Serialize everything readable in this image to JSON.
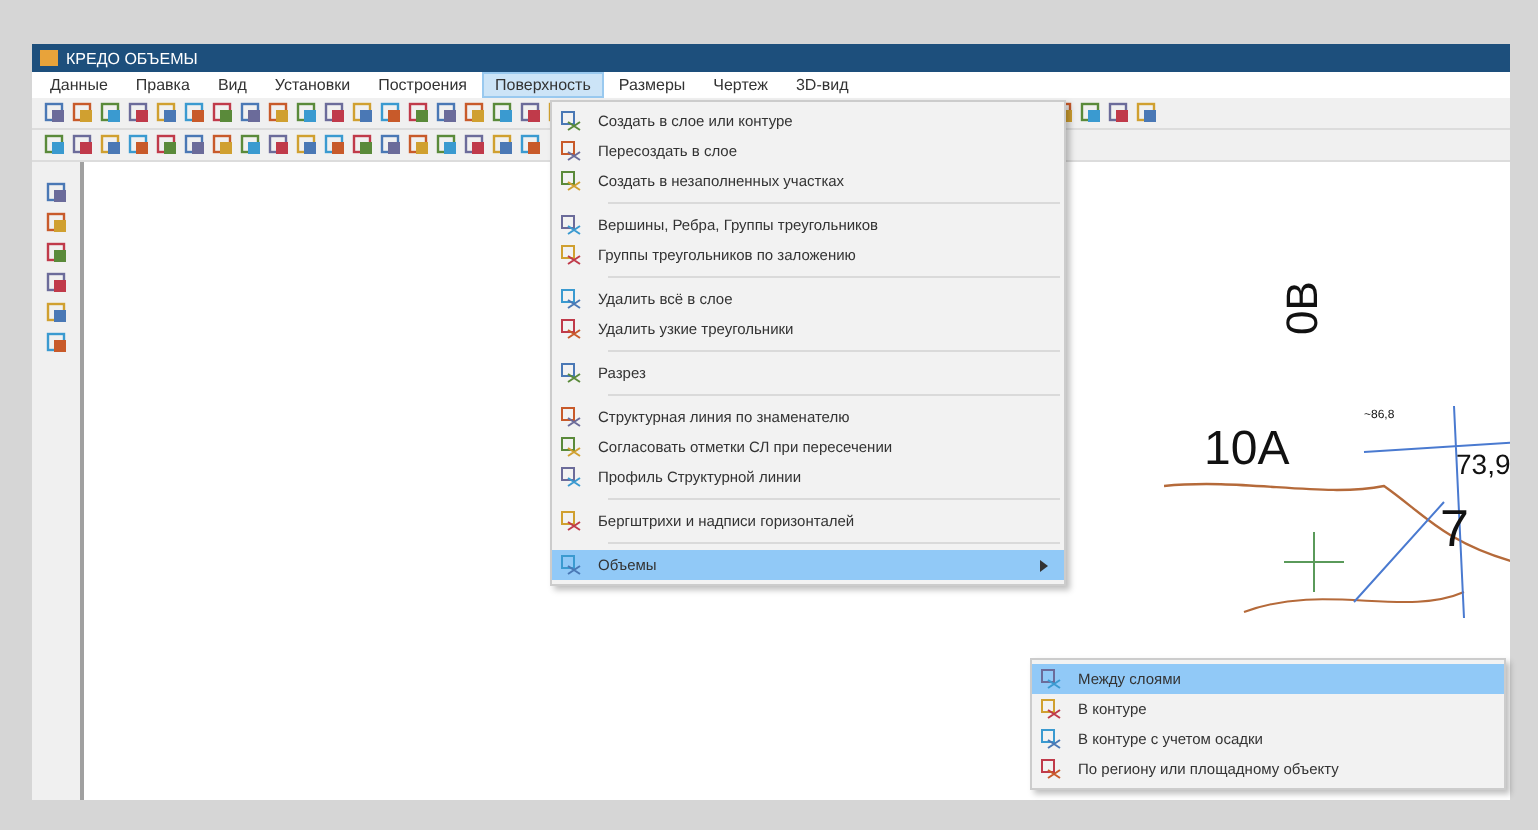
{
  "window": {
    "title": "КРЕДО ОБЪЕМЫ"
  },
  "menu_bar": [
    {
      "label": "Данные",
      "selected": false
    },
    {
      "label": "Правка",
      "selected": false
    },
    {
      "label": "Вид",
      "selected": false
    },
    {
      "label": "Установки",
      "selected": false
    },
    {
      "label": "Построения",
      "selected": false
    },
    {
      "label": "Поверхность",
      "selected": true
    },
    {
      "label": "Размеры",
      "selected": false
    },
    {
      "label": "Чертеж",
      "selected": false
    },
    {
      "label": "3D-вид",
      "selected": false
    }
  ],
  "dropdown": {
    "groups": [
      [
        {
          "label": "Создать в слое или контуре",
          "selected": false,
          "submenu": false
        },
        {
          "label": "Пересоздать в слое",
          "selected": false,
          "submenu": false
        },
        {
          "label": "Создать в незаполненных участках",
          "selected": false,
          "submenu": false
        }
      ],
      [
        {
          "label": "Вершины, Ребра, Группы треугольников",
          "selected": false,
          "submenu": false
        },
        {
          "label": "Группы треугольников по заложению",
          "selected": false,
          "submenu": false
        }
      ],
      [
        {
          "label": "Удалить всё в слое",
          "selected": false,
          "submenu": false
        },
        {
          "label": "Удалить узкие треугольники",
          "selected": false,
          "submenu": false
        }
      ],
      [
        {
          "label": "Разрез",
          "selected": false,
          "submenu": false
        }
      ],
      [
        {
          "label": "Структурная линия по знаменателю",
          "selected": false,
          "submenu": false
        },
        {
          "label": "Согласовать отметки СЛ при пересечении",
          "selected": false,
          "submenu": false
        },
        {
          "label": "Профиль Структурной линии",
          "selected": false,
          "submenu": false
        }
      ],
      [
        {
          "label": "Бергштрихи и надписи горизонталей",
          "selected": false,
          "submenu": false
        }
      ],
      [
        {
          "label": "Объемы",
          "selected": true,
          "submenu": true
        }
      ]
    ]
  },
  "submenu": [
    {
      "label": "Между слоями",
      "selected": true
    },
    {
      "label": "В контуре",
      "selected": false
    },
    {
      "label": "В контуре с учетом осадки",
      "selected": false
    },
    {
      "label": "По региону или площадному объекту",
      "selected": false
    }
  ],
  "canvas": {
    "labels": [
      {
        "text": "0В",
        "kind": "rotated"
      },
      {
        "text": "10А",
        "kind": "large"
      },
      {
        "text": "~86,8",
        "kind": "tiny"
      },
      {
        "text": "73,9",
        "kind": "small"
      },
      {
        "text": "7",
        "kind": "large"
      }
    ]
  }
}
